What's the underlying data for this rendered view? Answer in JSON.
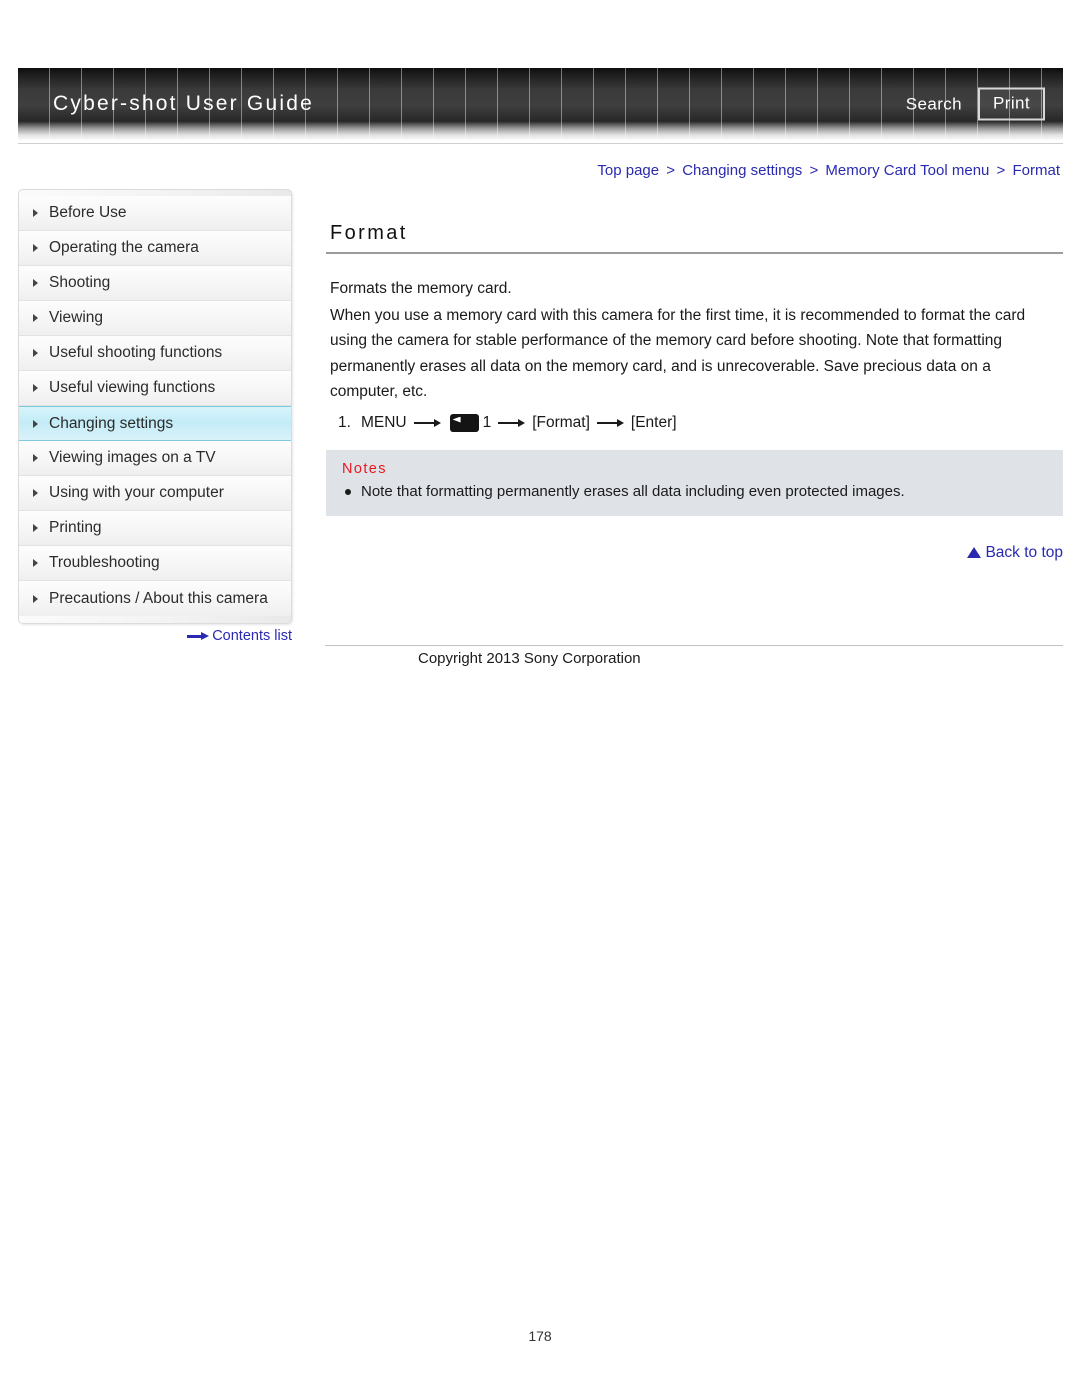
{
  "header": {
    "site_title": "Cyber-shot User Guide",
    "search_label": "Search",
    "print_label": "Print"
  },
  "breadcrumb": {
    "separator": ">",
    "items": [
      {
        "label": "Top page"
      },
      {
        "label": "Changing settings"
      },
      {
        "label": "Memory Card Tool menu"
      },
      {
        "label": "Format"
      }
    ],
    "link_color": "#2a2ab0"
  },
  "sidebar": {
    "items": [
      {
        "label": "Before Use",
        "active": false
      },
      {
        "label": "Operating the camera",
        "active": false
      },
      {
        "label": "Shooting",
        "active": false
      },
      {
        "label": "Viewing",
        "active": false
      },
      {
        "label": "Useful shooting functions",
        "active": false
      },
      {
        "label": "Useful viewing functions",
        "active": false
      },
      {
        "label": "Changing settings",
        "active": true
      },
      {
        "label": "Viewing images on a TV",
        "active": false
      },
      {
        "label": "Using with your computer",
        "active": false
      },
      {
        "label": "Printing",
        "active": false
      },
      {
        "label": "Troubleshooting",
        "active": false
      },
      {
        "label": "Precautions / About this camera",
        "active": false
      }
    ],
    "contents_list_label": "Contents list",
    "active_highlight_color": "#c3ecf7"
  },
  "main": {
    "title": "Format",
    "paragraphs": [
      "Formats the memory card.",
      "When you use a memory card with this camera for the first time, it is recommended to format the card using the camera for stable performance of the memory card before shooting. Note that formatting permanently erases all data on the memory card, and is unrecoverable. Save precious data on a computer, etc."
    ],
    "step": {
      "number": "1.",
      "menu_label": "MENU",
      "icon_name": "memory-card-tool-icon",
      "tab_number": "1",
      "target_label": "[Format]",
      "enter_label": "[Enter]"
    },
    "notes": {
      "heading": "Notes",
      "heading_color": "#e8171f",
      "background_color": "#dfe3e8",
      "items": [
        "Note that formatting permanently erases all data including even protected images."
      ]
    },
    "back_to_top_label": "Back to top"
  },
  "footer": {
    "copyright": "Copyright 2013 Sony Corporation",
    "page_number": "178"
  }
}
